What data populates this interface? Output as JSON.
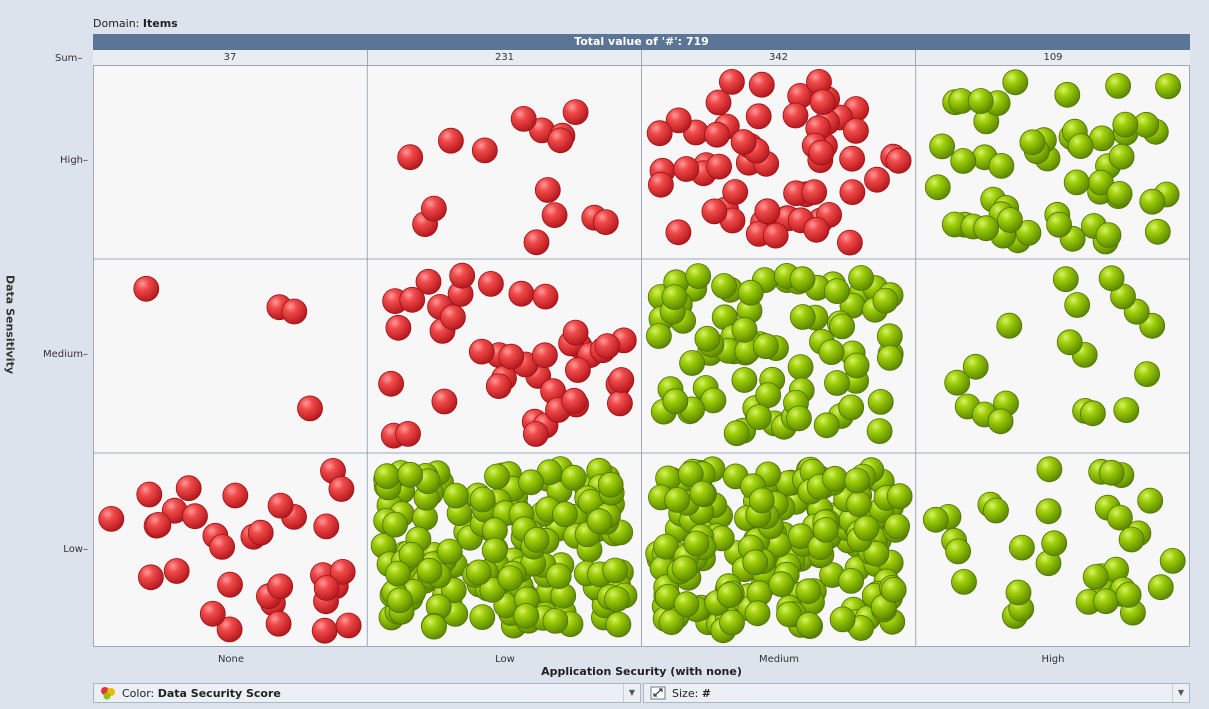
{
  "domain": {
    "label": "Domain:",
    "value": "Items"
  },
  "total_bar": "Total value of '#': 719",
  "sum_label": "Sum",
  "dropdowns": {
    "color": {
      "label": "Color:",
      "value": "Data Security Score"
    },
    "size": {
      "label": "Size:",
      "value": "#"
    }
  },
  "colors": {
    "red": "#e6323a",
    "green": "#8fc300"
  },
  "chart_data": {
    "type": "scatter",
    "title": "",
    "xlabel": "Application Security (with none)",
    "ylabel": "Data Sensitivity",
    "x_categories": [
      "None",
      "Low",
      "Medium",
      "High"
    ],
    "y_categories": [
      "High",
      "Medium",
      "Low"
    ],
    "column_sums": [
      37,
      231,
      342,
      109
    ],
    "total": 719,
    "cells": [
      {
        "x": "None",
        "y": "High",
        "count": 0,
        "color": "red"
      },
      {
        "x": "Low",
        "y": "High",
        "count": 15,
        "color": "red"
      },
      {
        "x": "Medium",
        "y": "High",
        "count": 58,
        "color": "red"
      },
      {
        "x": "High",
        "y": "High",
        "count": 55,
        "color": "green"
      },
      {
        "x": "None",
        "y": "Medium",
        "count": 4,
        "color": "red"
      },
      {
        "x": "Low",
        "y": "Medium",
        "count": 42,
        "color": "red"
      },
      {
        "x": "Medium",
        "y": "Medium",
        "count": 84,
        "color": "green"
      },
      {
        "x": "High",
        "y": "Medium",
        "count": 19,
        "color": "green"
      },
      {
        "x": "None",
        "y": "Low",
        "count": 33,
        "color": "red"
      },
      {
        "x": "Low",
        "y": "Low",
        "count": 174,
        "color": "green"
      },
      {
        "x": "Medium",
        "y": "Low",
        "count": 200,
        "color": "green"
      },
      {
        "x": "High",
        "y": "Low",
        "count": 35,
        "color": "green"
      }
    ]
  }
}
